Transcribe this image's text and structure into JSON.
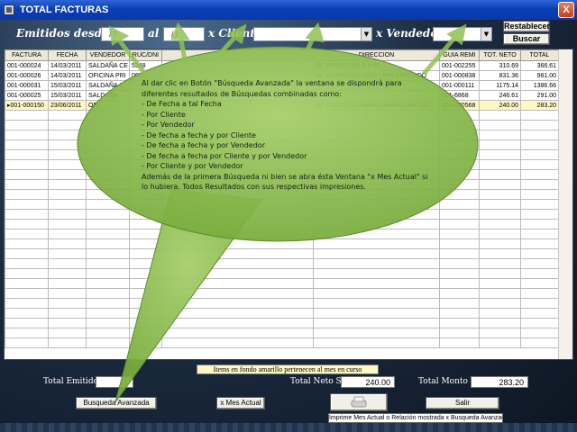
{
  "window": {
    "title": "TOTAL FACTURAS",
    "close_glyph": "X"
  },
  "filters": {
    "label_from": "Emitidos desde el",
    "date_from": "/  /",
    "label_to": "al",
    "date_to": "/  /",
    "label_client": "x Cliente",
    "label_vendor": "x Vendedor",
    "restablecer_label": "Restablecer",
    "buscar_label": "Buscar"
  },
  "table": {
    "columns": [
      "FACTURA",
      "FECHA",
      "VENDEDOR",
      "RUC/DNI",
      "",
      "DIRECCION",
      "GUIA REMI",
      "TOT. NETO",
      "TOTAL"
    ],
    "rows": [
      {
        "factura": "001-000024",
        "fecha": "14/03/2011",
        "vendedor": "SALDAÑA CE",
        "ruc": "5548",
        "cliente": "",
        "direccion": "AV. PERU 1783 S.M.P.",
        "guia": "001-002255",
        "neto": "310.69",
        "total": "366.61"
      },
      {
        "factura": "001-000026",
        "fecha": "14/03/2011",
        "vendedor": "OFICINA PRI",
        "ruc": "0000",
        "cliente": "",
        "direccion": "AV. AZANGARO 1000 LIMA CERCADO",
        "guia": "001-000838",
        "neto": "831.36",
        "total": "981.00"
      },
      {
        "factura": "001-000031",
        "fecha": "15/03/2011",
        "vendedor": "SALDAÑA C",
        "ruc": "",
        "cliente": "",
        "direccion": "",
        "guia": "001-000111",
        "neto": "1175.14",
        "total": "1386.66"
      },
      {
        "factura": "001-000025",
        "fecha": "15/03/2011",
        "vendedor": "SALDAÑA",
        "ruc": "",
        "cliente": "",
        "direccion": "",
        "guia": "001-6868",
        "neto": "246.61",
        "total": "291.00"
      },
      {
        "factura": "001-000150",
        "fecha": "23/06/2011",
        "vendedor": "OFI",
        "ruc": "",
        "cliente": "",
        "direccion": "AV. OSCAR RICARDO BENAVIDES 310",
        "guia": "001-000568",
        "neto": "240.00",
        "total": "283.20"
      }
    ]
  },
  "footer": {
    "note": "Items en fondo amarillo pertenecen al mes en curso",
    "total_emitidos_label": "Total Emitidos",
    "total_emitidos_value": "",
    "total_neto_label": "Total Neto S/.",
    "total_neto_value": "240.00",
    "total_monto_label": "Total Monto S/.",
    "total_monto_value": "283.20",
    "busqueda_label": "Busqueda Avanzada",
    "mes_actual_label": "x Mes Actual",
    "salir_label": "Salir",
    "print_caption": "Imprime Mes Actual o Relación mostrada x Busqueda Avanzada"
  },
  "balloon": {
    "intro": "Al dar clic en Botón \"Búsqueda Avanzada\" la ventana se dispondrá para diferentes resultados de Búsquedas combinadas como:",
    "items": [
      "- De Fecha a tal Fecha",
      "- Por Cliente",
      "- Por Vendedor",
      "- De fecha a fecha y por Cliente",
      "- De fecha a fecha y por Vendedor",
      "- De fecha a fecha por Cliente y por Vendedor",
      "- Por Cliente y por Vendedor"
    ],
    "outro": "Además de la primera Búsqueda ni bien se abra ésta Ventana \"x Mes Actual\" si lo hubiera. Todos Resultados con sus respectivas impresiones.",
    "fill_color": "#8fc154"
  },
  "colors": {
    "highlight_row": "#fdf8c4",
    "titlebar": "#0a3fb8"
  }
}
